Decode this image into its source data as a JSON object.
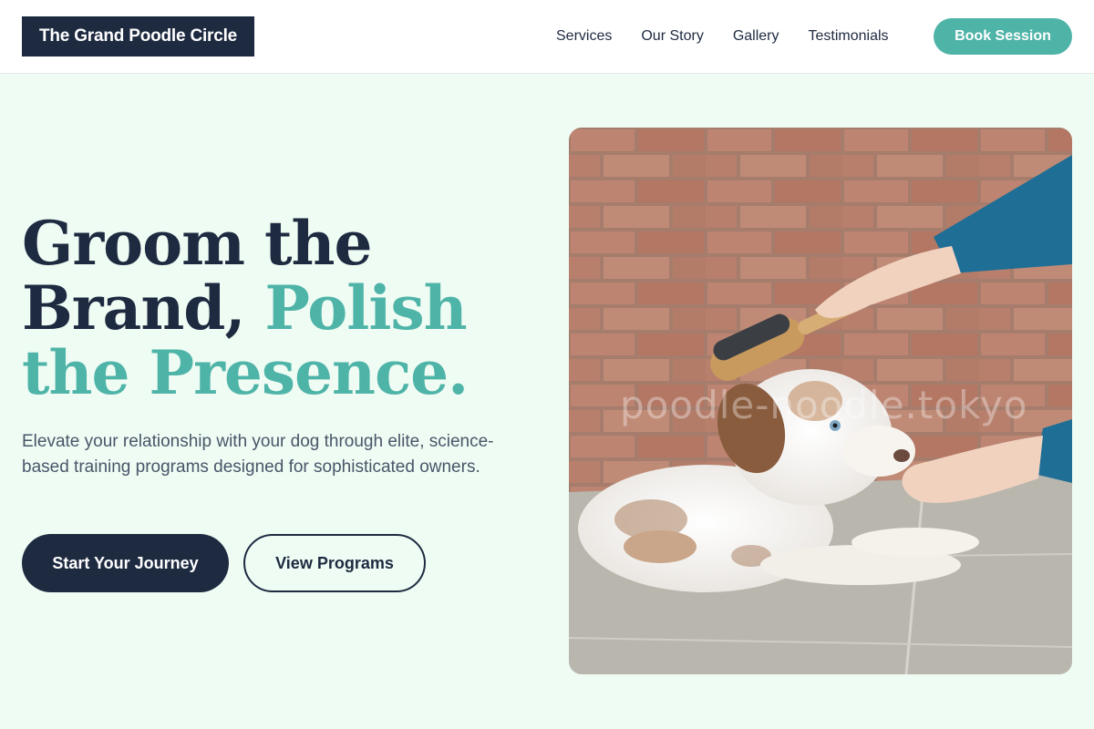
{
  "header": {
    "brand": "The Grand Poodle Circle",
    "nav": [
      {
        "label": "Services"
      },
      {
        "label": "Our Story"
      },
      {
        "label": "Gallery"
      },
      {
        "label": "Testimonials"
      }
    ],
    "cta_label": "Book Session"
  },
  "hero": {
    "title_line1": "Groom the",
    "title_line2_plain": "Brand, ",
    "title_line2_accent": "Polish",
    "title_line3_accent": "the Presence.",
    "subtitle": "Elevate your relationship with your dog through elite, science-based training programs designed for sophisticated owners.",
    "primary_button": "Start Your Journey",
    "secondary_button": "View Programs",
    "image_watermark": "poodle-noodle.tokyo"
  },
  "colors": {
    "navy": "#1e2a40",
    "teal": "#4fb4a8",
    "background": "#effcf4"
  },
  "icons": {
    "hero_image": "puppy-being-brushed-photo"
  }
}
